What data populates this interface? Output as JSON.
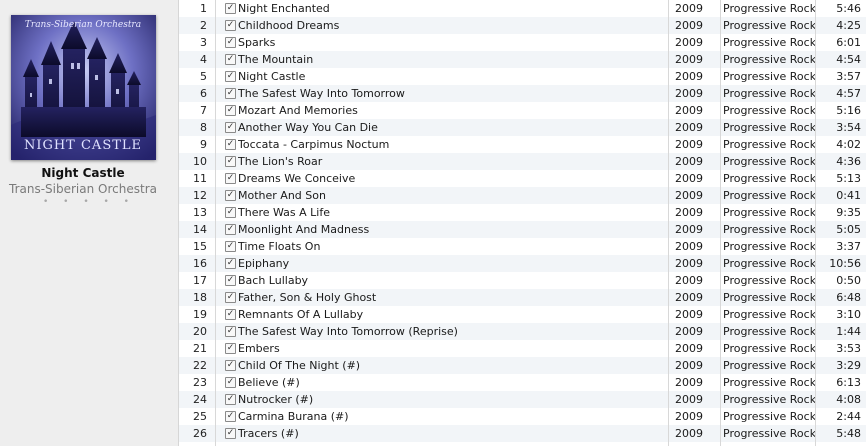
{
  "album": {
    "title": "Night Castle",
    "artist": "Trans-Siberian Orchestra",
    "rating_dots": "• • • • •",
    "cover": {
      "band_text": "Trans-Siberian Orchestra",
      "title_text": "NIGHT CASTLE"
    }
  },
  "tracks": [
    {
      "num": "1",
      "title": "Night Enchanted",
      "year": "2009",
      "genre": "Progressive Rock",
      "time": "5:46"
    },
    {
      "num": "2",
      "title": "Childhood Dreams",
      "year": "2009",
      "genre": "Progressive Rock",
      "time": "4:25"
    },
    {
      "num": "3",
      "title": "Sparks",
      "year": "2009",
      "genre": "Progressive Rock",
      "time": "6:01"
    },
    {
      "num": "4",
      "title": "The Mountain",
      "year": "2009",
      "genre": "Progressive Rock",
      "time": "4:54"
    },
    {
      "num": "5",
      "title": "Night Castle",
      "year": "2009",
      "genre": "Progressive Rock",
      "time": "3:57"
    },
    {
      "num": "6",
      "title": "The Safest Way Into Tomorrow",
      "year": "2009",
      "genre": "Progressive Rock",
      "time": "4:57"
    },
    {
      "num": "7",
      "title": "Mozart And Memories",
      "year": "2009",
      "genre": "Progressive Rock",
      "time": "5:16"
    },
    {
      "num": "8",
      "title": "Another Way You Can Die",
      "year": "2009",
      "genre": "Progressive Rock",
      "time": "3:54"
    },
    {
      "num": "9",
      "title": "Toccata - Carpimus Noctum",
      "year": "2009",
      "genre": "Progressive Rock",
      "time": "4:02"
    },
    {
      "num": "10",
      "title": "The Lion's Roar",
      "year": "2009",
      "genre": "Progressive Rock",
      "time": "4:36"
    },
    {
      "num": "11",
      "title": "Dreams We Conceive",
      "year": "2009",
      "genre": "Progressive Rock",
      "time": "5:13"
    },
    {
      "num": "12",
      "title": "Mother And Son",
      "year": "2009",
      "genre": "Progressive Rock",
      "time": "0:41"
    },
    {
      "num": "13",
      "title": "There Was A Life",
      "year": "2009",
      "genre": "Progressive Rock",
      "time": "9:35"
    },
    {
      "num": "14",
      "title": "Moonlight And Madness",
      "year": "2009",
      "genre": "Progressive Rock",
      "time": "5:05"
    },
    {
      "num": "15",
      "title": "Time Floats On",
      "year": "2009",
      "genre": "Progressive Rock",
      "time": "3:37"
    },
    {
      "num": "16",
      "title": "Epiphany",
      "year": "2009",
      "genre": "Progressive Rock",
      "time": "10:56"
    },
    {
      "num": "17",
      "title": "Bach Lullaby",
      "year": "2009",
      "genre": "Progressive Rock",
      "time": "0:50"
    },
    {
      "num": "18",
      "title": "Father, Son & Holy Ghost",
      "year": "2009",
      "genre": "Progressive Rock",
      "time": "6:48"
    },
    {
      "num": "19",
      "title": "Remnants Of A Lullaby",
      "year": "2009",
      "genre": "Progressive Rock",
      "time": "3:10"
    },
    {
      "num": "20",
      "title": "The Safest Way Into Tomorrow (Reprise)",
      "year": "2009",
      "genre": "Progressive Rock",
      "time": "1:44"
    },
    {
      "num": "21",
      "title": "Embers",
      "year": "2009",
      "genre": "Progressive Rock",
      "time": "3:53"
    },
    {
      "num": "22",
      "title": "Child Of The Night (#)",
      "year": "2009",
      "genre": "Progressive Rock",
      "time": "3:29"
    },
    {
      "num": "23",
      "title": "Believe (#)",
      "year": "2009",
      "genre": "Progressive Rock",
      "time": "6:13"
    },
    {
      "num": "24",
      "title": "Nutrocker (#)",
      "year": "2009",
      "genre": "Progressive Rock",
      "time": "4:08"
    },
    {
      "num": "25",
      "title": "Carmina Burana (#)",
      "year": "2009",
      "genre": "Progressive Rock",
      "time": "2:44"
    },
    {
      "num": "26",
      "title": "Tracers (#)",
      "year": "2009",
      "genre": "Progressive Rock",
      "time": "5:48"
    }
  ],
  "check_glyph": "✓",
  "colors": {
    "stripe": "#f2f5f8",
    "divider": "#d8d8d8",
    "panel": "#eeeeee"
  }
}
